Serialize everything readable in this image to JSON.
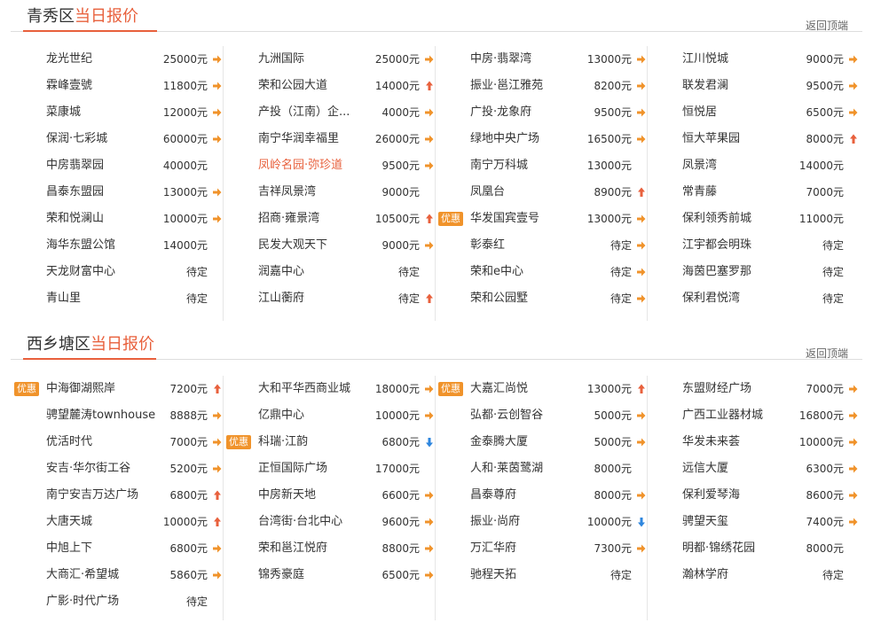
{
  "colors": {
    "accent": "#e8603c",
    "badge": "#f0932b",
    "arrow_right": "#f0932b",
    "arrow_up": "#e8603c",
    "arrow_down": "#2e86de"
  },
  "sections": [
    {
      "name": "qingxiu",
      "title_main": "青秀区",
      "title_highlight": "当日报价",
      "back_top": "返回顶端",
      "columns": [
        [
          {
            "name": "龙光世纪",
            "price": "25000元",
            "trend": "right"
          },
          {
            "name": "霖峰壹號",
            "price": "11800元",
            "trend": "right"
          },
          {
            "name": "菜康城",
            "price": "12000元",
            "trend": "right"
          },
          {
            "name": "保润·七彩城",
            "price": "60000元",
            "trend": "right"
          },
          {
            "name": "中房翡翠园",
            "price": "40000元",
            "trend": ""
          },
          {
            "name": "昌泰东盟园",
            "price": "13000元",
            "trend": "right"
          },
          {
            "name": "荣和悦澜山",
            "price": "10000元",
            "trend": "right"
          },
          {
            "name": "海华东盟公馆",
            "price": "14000元",
            "trend": ""
          },
          {
            "name": "天龙财富中心",
            "price": "待定",
            "trend": ""
          },
          {
            "name": "青山里",
            "price": "待定",
            "trend": ""
          }
        ],
        [
          {
            "name": "九洲国际",
            "price": "25000元",
            "trend": "right"
          },
          {
            "name": "荣和公园大道",
            "price": "14000元",
            "trend": "up"
          },
          {
            "name": "产投（江南）企...",
            "price": "4000元",
            "trend": "right"
          },
          {
            "name": "南宁华润幸福里",
            "price": "26000元",
            "trend": "right"
          },
          {
            "name": "凤岭名园·弥珍道",
            "price": "9500元",
            "trend": "right",
            "red": true
          },
          {
            "name": "吉祥凤景湾",
            "price": "9000元",
            "trend": ""
          },
          {
            "name": "招商·雍景湾",
            "price": "10500元",
            "trend": "up"
          },
          {
            "name": "民发大观天下",
            "price": "9000元",
            "trend": "right"
          },
          {
            "name": "润嘉中心",
            "price": "待定",
            "trend": ""
          },
          {
            "name": "江山蘅府",
            "price": "待定",
            "trend": "up"
          }
        ],
        [
          {
            "name": "中房·翡翠湾",
            "price": "13000元",
            "trend": "right"
          },
          {
            "name": "振业·邕江雅苑",
            "price": "8200元",
            "trend": "right"
          },
          {
            "name": "广投·龙象府",
            "price": "9500元",
            "trend": "right"
          },
          {
            "name": "绿地中央广场",
            "price": "16500元",
            "trend": "right"
          },
          {
            "name": "南宁万科城",
            "price": "13000元",
            "trend": ""
          },
          {
            "name": "凤凰台",
            "price": "8900元",
            "trend": "up"
          },
          {
            "name": "华发国宾壹号",
            "price": "13000元",
            "trend": "right",
            "badge": "优惠"
          },
          {
            "name": "彰泰红",
            "price": "待定",
            "trend": "right"
          },
          {
            "name": "荣和e中心",
            "price": "待定",
            "trend": "right"
          },
          {
            "name": "荣和公园墅",
            "price": "待定",
            "trend": "right"
          }
        ],
        [
          {
            "name": "江川悦城",
            "price": "9000元",
            "trend": "right"
          },
          {
            "name": "联发君澜",
            "price": "9500元",
            "trend": "right"
          },
          {
            "name": "恒悦居",
            "price": "6500元",
            "trend": "right"
          },
          {
            "name": "恒大苹果园",
            "price": "8000元",
            "trend": "up"
          },
          {
            "name": "凤景湾",
            "price": "14000元",
            "trend": ""
          },
          {
            "name": "常青藤",
            "price": "7000元",
            "trend": ""
          },
          {
            "name": "保利领秀前城",
            "price": "11000元",
            "trend": ""
          },
          {
            "name": "江宇都会明珠",
            "price": "待定",
            "trend": ""
          },
          {
            "name": "海茵巴塞罗那",
            "price": "待定",
            "trend": ""
          },
          {
            "name": "保利君悦湾",
            "price": "待定",
            "trend": ""
          }
        ]
      ]
    },
    {
      "name": "xixiangtang",
      "title_main": "西乡塘区",
      "title_highlight": "当日报价",
      "back_top": "返回顶端",
      "columns": [
        [
          {
            "name": "中海御湖熙岸",
            "price": "7200元",
            "trend": "up",
            "badge": "优惠"
          },
          {
            "name": "骋望麓涛townhouse",
            "price": "8888元",
            "trend": "right"
          },
          {
            "name": "优活时代",
            "price": "7000元",
            "trend": "right"
          },
          {
            "name": "安吉·华尔街工谷",
            "price": "5200元",
            "trend": "right"
          },
          {
            "name": "南宁安吉万达广场",
            "price": "6800元",
            "trend": "up"
          },
          {
            "name": "大唐天城",
            "price": "10000元",
            "trend": "up"
          },
          {
            "name": "中旭上下",
            "price": "6800元",
            "trend": "right"
          },
          {
            "name": "大商汇·希望城",
            "price": "5860元",
            "trend": "right"
          },
          {
            "name": "广影·时代广场",
            "price": "待定",
            "trend": ""
          }
        ],
        [
          {
            "name": "大和平华西商业城",
            "price": "18000元",
            "trend": "right"
          },
          {
            "name": "亿鼎中心",
            "price": "10000元",
            "trend": "right"
          },
          {
            "name": "科瑞·江韵",
            "price": "6800元",
            "trend": "down",
            "badge": "优惠"
          },
          {
            "name": "正恒国际广场",
            "price": "17000元",
            "trend": ""
          },
          {
            "name": "中房新天地",
            "price": "6600元",
            "trend": "right"
          },
          {
            "name": "台湾街·台北中心",
            "price": "9600元",
            "trend": "right"
          },
          {
            "name": "荣和邕江悦府",
            "price": "8800元",
            "trend": "right"
          },
          {
            "name": "锦秀豪庭",
            "price": "6500元",
            "trend": "right"
          }
        ],
        [
          {
            "name": "大嘉汇尚悦",
            "price": "13000元",
            "trend": "up",
            "badge": "优惠"
          },
          {
            "name": "弘都·云创智谷",
            "price": "5000元",
            "trend": "right"
          },
          {
            "name": "金泰腾大厦",
            "price": "5000元",
            "trend": "right"
          },
          {
            "name": "人和·莱茵鹭湖",
            "price": "8000元",
            "trend": ""
          },
          {
            "name": "昌泰尊府",
            "price": "8000元",
            "trend": "right"
          },
          {
            "name": "振业·尚府",
            "price": "10000元",
            "trend": "down"
          },
          {
            "name": "万汇华府",
            "price": "7300元",
            "trend": "right"
          },
          {
            "name": "驰程天拓",
            "price": "待定",
            "trend": ""
          }
        ],
        [
          {
            "name": "东盟财经广场",
            "price": "7000元",
            "trend": "right"
          },
          {
            "name": "广西工业器材城",
            "price": "16800元",
            "trend": "right"
          },
          {
            "name": "华发未来荟",
            "price": "10000元",
            "trend": "right"
          },
          {
            "name": "远信大厦",
            "price": "6300元",
            "trend": "right"
          },
          {
            "name": "保利爱琴海",
            "price": "8600元",
            "trend": "right"
          },
          {
            "name": "骋望天玺",
            "price": "7400元",
            "trend": "right"
          },
          {
            "name": "明都·锦绣花园",
            "price": "8000元",
            "trend": ""
          },
          {
            "name": "瀚林学府",
            "price": "待定",
            "trend": ""
          }
        ]
      ]
    }
  ]
}
